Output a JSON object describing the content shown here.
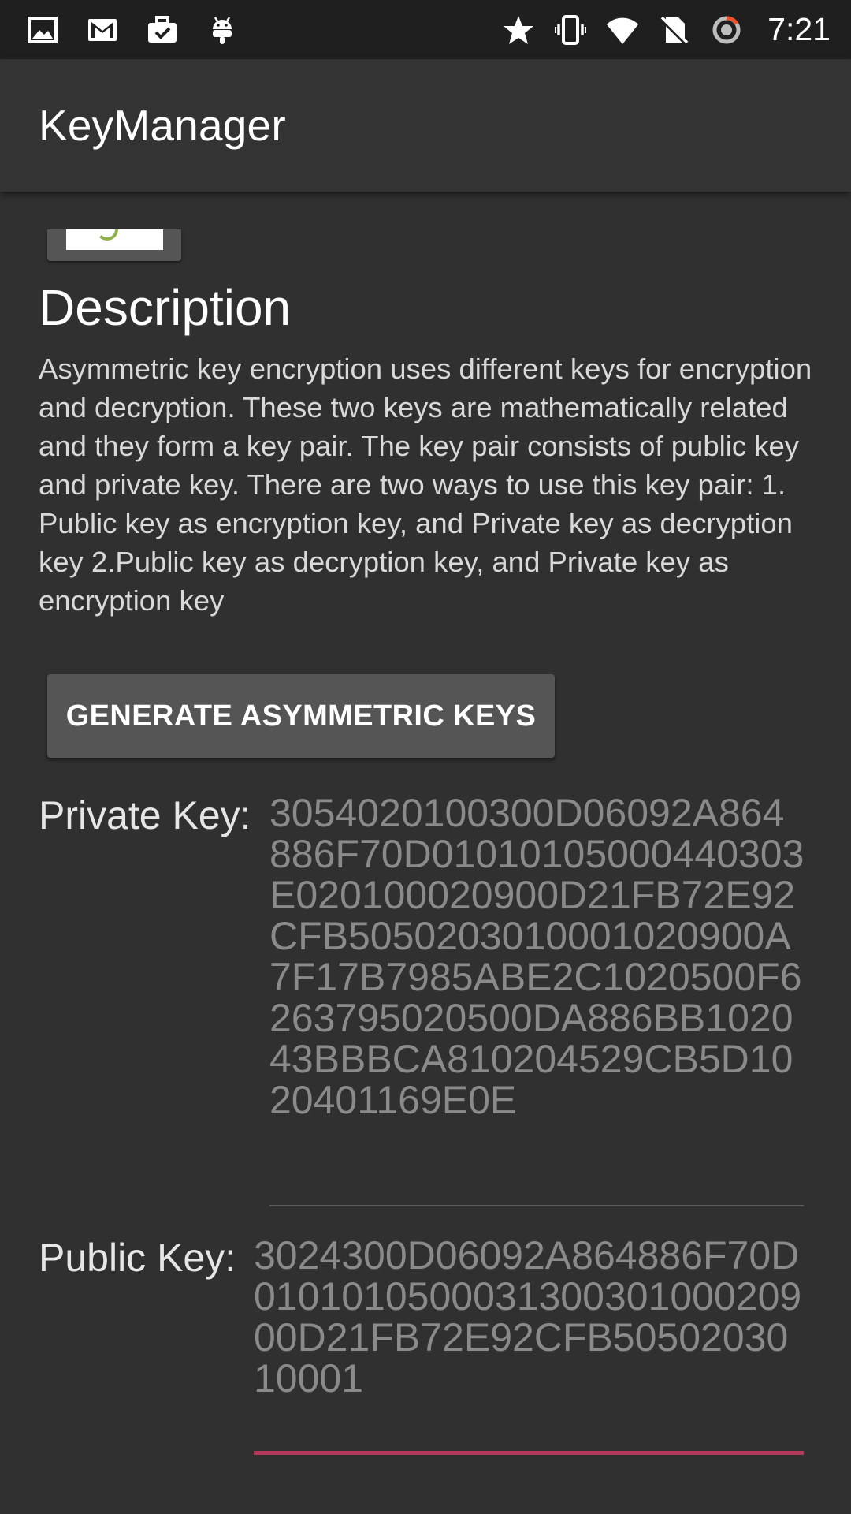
{
  "status_bar": {
    "time": "7:21",
    "left_icons": [
      "gallery-icon",
      "gmail-icon",
      "briefcase-check-icon",
      "android-icon"
    ],
    "right_icons": [
      "star-icon",
      "vibrate-icon",
      "wifi-icon",
      "no-sim-icon",
      "sync-ring-icon"
    ]
  },
  "app_bar": {
    "title": "KeyManager"
  },
  "main": {
    "section_title": "Description",
    "description": "Asymmetric key encryption uses different keys for encryption and decryption. These two keys are mathematically related and they form a key pair. The key pair consists of public key and private key. There are two ways to use this key pair: 1. Public key as encryption key, and Private key as decryption key 2.Public key as decryption key, and Private key as encryption key",
    "generate_button_label": "GENERATE ASYMMETRIC KEYS",
    "private_key": {
      "label": "Private Key:",
      "value": "3054020100300D06092A864886F70D01010105000440303E020100020900D21FB72E92CFB5050203010001020900A7F17B7985ABE2C1020500F6263795020500DA886BB102043BBBCA810204529CB5D1020401169E0E"
    },
    "public_key": {
      "label": "Public Key:",
      "value": "3024300D06092A864886F70D010101050003130030100020900D21FB72E92CFB5050203010001"
    }
  },
  "colors": {
    "background": "#303030",
    "app_bar": "#333333",
    "status_bar": "#1f1f1f",
    "button": "#555555",
    "accent_underline": "#b03a5a"
  }
}
